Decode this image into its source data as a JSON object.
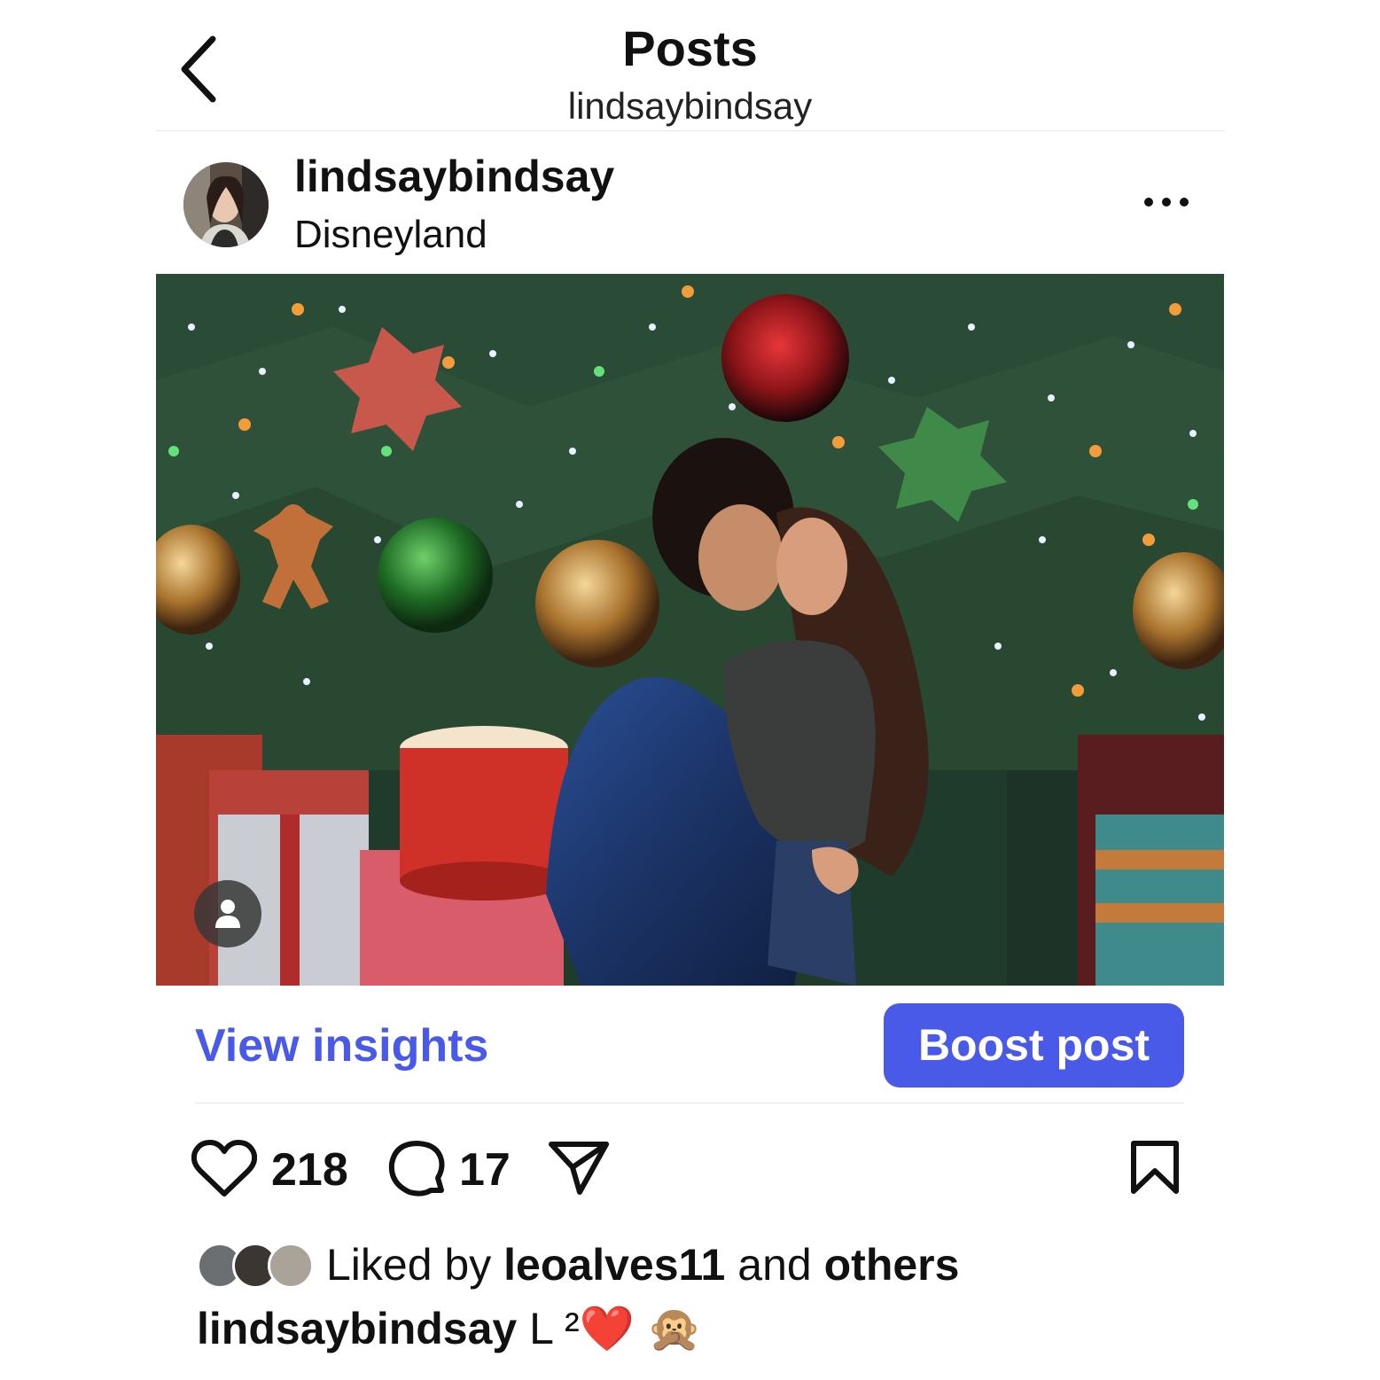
{
  "header": {
    "title": "Posts",
    "subtitle": "lindsaybindsay"
  },
  "post": {
    "username": "lindsaybindsay",
    "location": "Disneyland",
    "photo_description_icon": "tag-people-icon"
  },
  "insights": {
    "view_label": "View insights",
    "boost_label": "Boost post",
    "accent_color": "#4a5ae8"
  },
  "engagement": {
    "likes": "218",
    "comments": "17"
  },
  "liked_by": {
    "prefix": "Liked by",
    "user": "leoalves11",
    "connector": "and",
    "others": "others"
  },
  "caption": {
    "username": "lindsaybindsay",
    "text": "L ²❤️ 🙊"
  }
}
